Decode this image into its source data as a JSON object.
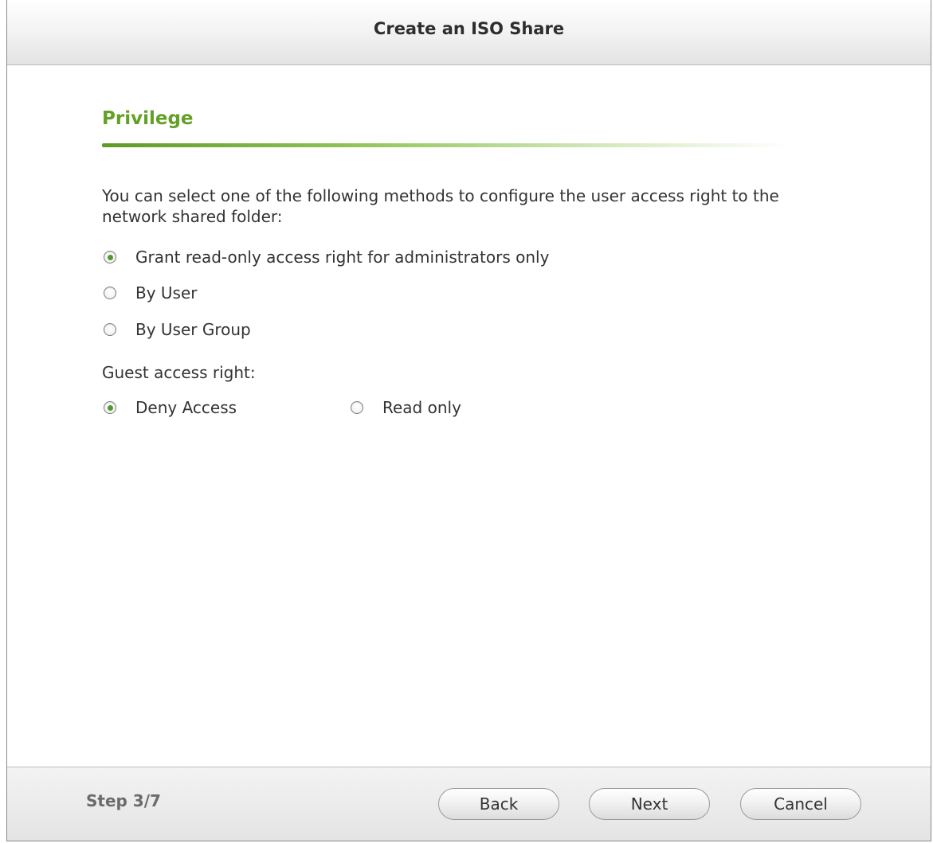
{
  "dialog": {
    "title": "Create an ISO Share"
  },
  "section": {
    "title": "Privilege"
  },
  "description": "You can select one of the following methods to configure the user access right to the network shared folder:",
  "access_methods": [
    {
      "label": "Grant read-only access right for administrators only",
      "checked": true
    },
    {
      "label": "By User",
      "checked": false
    },
    {
      "label": "By User Group",
      "checked": false
    }
  ],
  "guest": {
    "label": "Guest access right:",
    "options": [
      {
        "label": "Deny Access",
        "checked": true
      },
      {
        "label": "Read only",
        "checked": false
      }
    ]
  },
  "footer": {
    "step": "Step 3/7",
    "back_label": "Back",
    "next_label": "Next",
    "cancel_label": "Cancel"
  },
  "colors": {
    "accent_green": "#63a026",
    "radio_checked": "#4f9a2c"
  }
}
